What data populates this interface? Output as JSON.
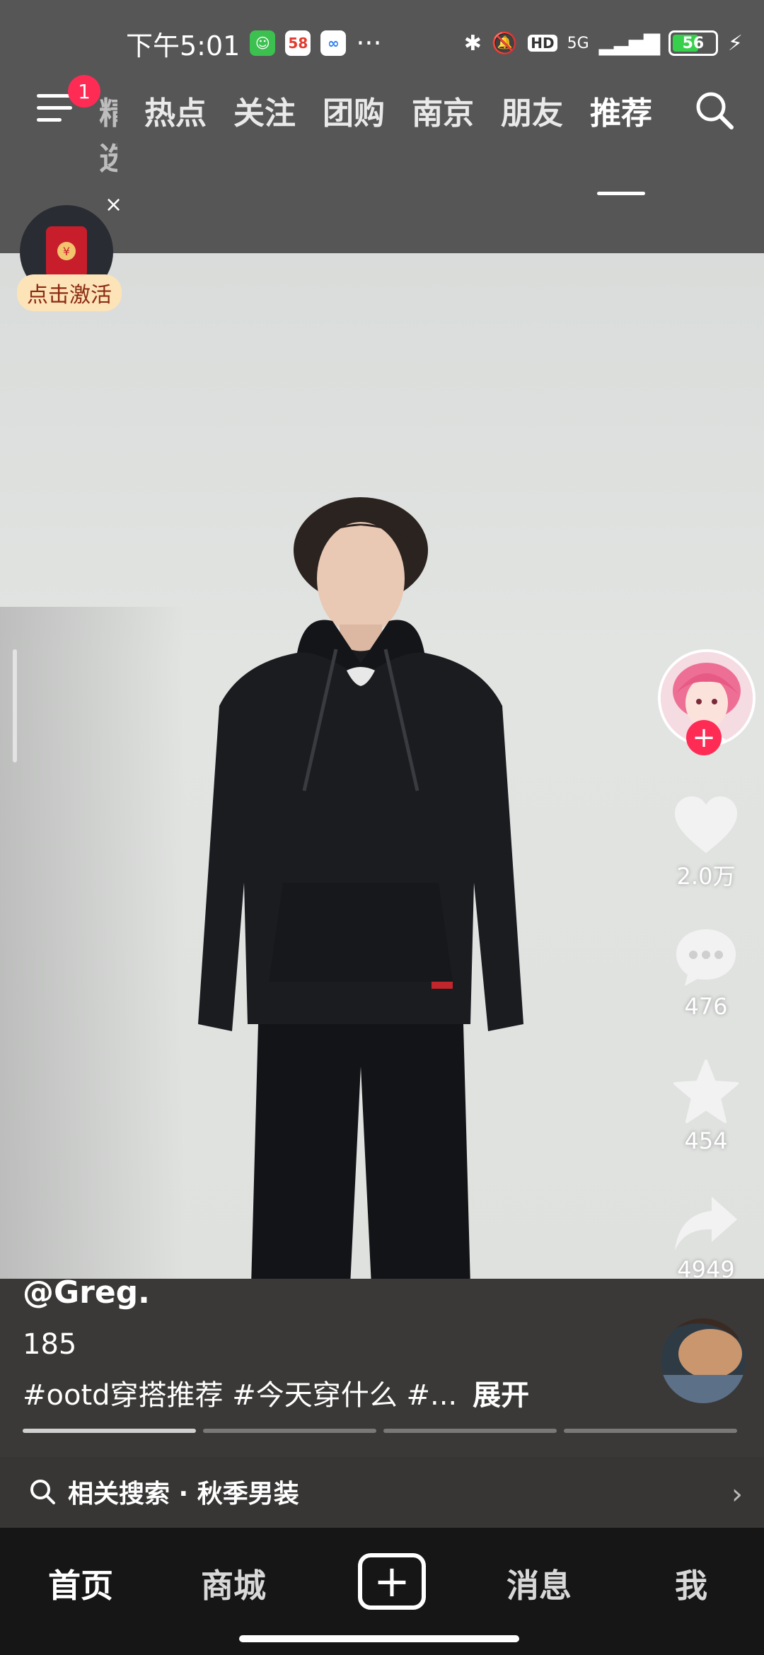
{
  "status_bar": {
    "time": "下午5:01",
    "more": "···",
    "network": "5G",
    "hd_badge": "HD",
    "battery_level": "56",
    "app_icons": [
      "wechat-like-icon",
      "58-app-icon",
      "cloud-app-icon"
    ]
  },
  "top_nav": {
    "notification_count": "1",
    "tabs": [
      "热点",
      "关注",
      "团购",
      "南京",
      "朋友",
      "推荐"
    ],
    "partial_tab": "精选",
    "active_tab": "推荐"
  },
  "promo": {
    "label": "点击激活",
    "close": "×"
  },
  "actions": {
    "likes": "2.0万",
    "comments": "476",
    "favorites": "454",
    "shares": "4949"
  },
  "video": {
    "author": "@Greg.",
    "description": "185",
    "tags": "#ootd穿搭推荐 #今天穿什么 #...",
    "expand_label": "展开",
    "progress_segments": 4,
    "progress_done": 1
  },
  "related_search": {
    "text": "相关搜索 · 秋季男装"
  },
  "bottom_nav": {
    "items": [
      "首页",
      "商城",
      "消息",
      "我"
    ],
    "create": "+"
  },
  "colors": {
    "accent": "#fe2c55",
    "top_background": "#565656",
    "bottom_background": "#161616"
  }
}
